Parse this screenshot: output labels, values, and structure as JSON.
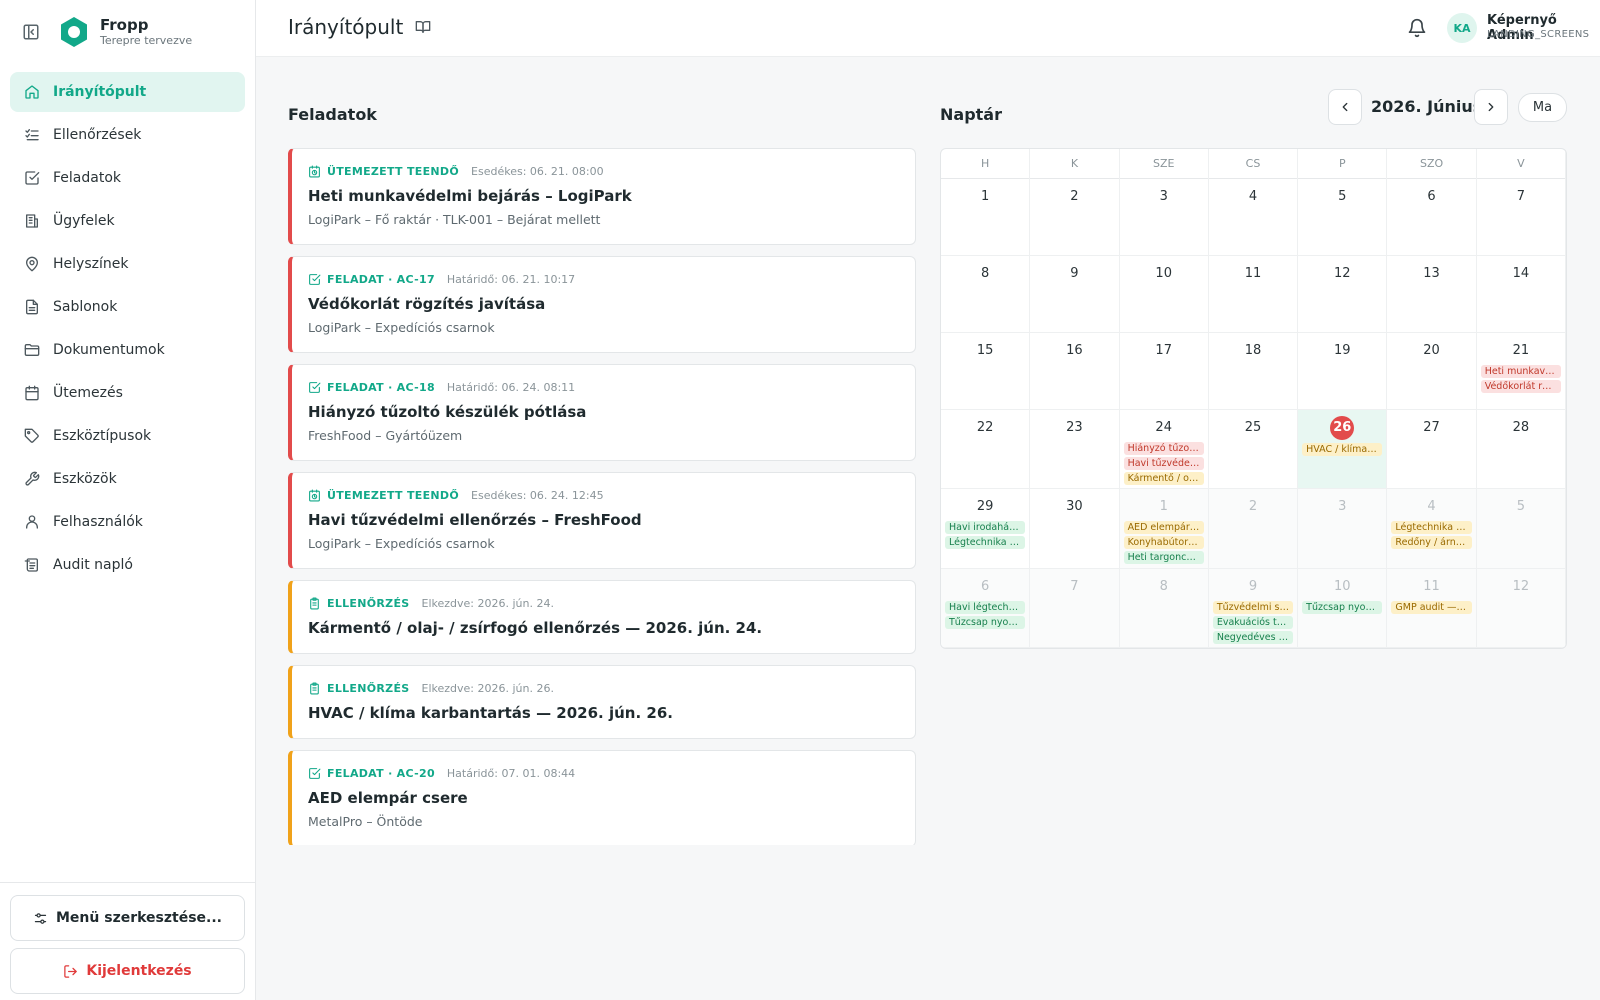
{
  "brand": {
    "name": "Fropp",
    "tagline": "Terepre tervezve"
  },
  "nav": [
    {
      "label": "Irányítópult",
      "icon": "home-icon",
      "active": true
    },
    {
      "label": "Ellenőrzések",
      "icon": "checklist-icon"
    },
    {
      "label": "Feladatok",
      "icon": "checkbox-icon"
    },
    {
      "label": "Ügyfelek",
      "icon": "building-icon"
    },
    {
      "label": "Helyszínek",
      "icon": "map-pin-icon"
    },
    {
      "label": "Sablonok",
      "icon": "file-text-icon"
    },
    {
      "label": "Dokumentumok",
      "icon": "folder-icon"
    },
    {
      "label": "Ütemezés",
      "icon": "calendar-icon"
    },
    {
      "label": "Eszköztípusok",
      "icon": "tag-icon"
    },
    {
      "label": "Eszközök",
      "icon": "wrench-icon"
    },
    {
      "label": "Felhasználók",
      "icon": "user-icon"
    },
    {
      "label": "Audit napló",
      "icon": "log-icon"
    }
  ],
  "sidebar_bottom": {
    "edit_menu": "Menü szerkesztése...",
    "logout": "Kijelentkezés"
  },
  "header": {
    "title": "Irányítópult"
  },
  "user": {
    "initials": "KA",
    "name": "Képernyő Admin",
    "org": "LANDING_SCREENS"
  },
  "tasks_section": {
    "title": "Feladatok",
    "items": [
      {
        "kind": "scheduled",
        "type": "ÜTEMEZETT TEENDŐ",
        "due": "Esedékes: 06. 21. 08:00",
        "title": "Heti munkavédelmi bejárás – LogiPark",
        "sub": "LogiPark – Fő raktár · TLK-001 – Bejárat mellett",
        "color": "red"
      },
      {
        "kind": "task",
        "type": "FELADAT · AC-17",
        "due": "Határidő: 06. 21. 10:17",
        "title": "Védőkorlát rögzítés javítása",
        "sub": "LogiPark – Expedíciós csarnok",
        "color": "red"
      },
      {
        "kind": "task",
        "type": "FELADAT · AC-18",
        "due": "Határidő: 06. 24. 08:11",
        "title": "Hiányzó tűzoltó készülék pótlása",
        "sub": "FreshFood – Gyártóüzem",
        "color": "red"
      },
      {
        "kind": "scheduled",
        "type": "ÜTEMEZETT TEENDŐ",
        "due": "Esedékes: 06. 24. 12:45",
        "title": "Havi tűzvédelmi ellenőrzés – FreshFood",
        "sub": "LogiPark – Expedíciós csarnok",
        "color": "red"
      },
      {
        "kind": "inspection",
        "type": "ELLENŐRZÉS",
        "due": "Elkezdve: 2026. jún. 24.",
        "title": "Kármentő / olaj- / zsírfogó ellenőrzés — 2026. jún. 24.",
        "sub": "",
        "color": "orange"
      },
      {
        "kind": "inspection",
        "type": "ELLENŐRZÉS",
        "due": "Elkezdve: 2026. jún. 26.",
        "title": "HVAC / klíma karbantartás — 2026. jún. 26.",
        "sub": "",
        "color": "orange"
      },
      {
        "kind": "task",
        "type": "FELADAT · AC-20",
        "due": "Határidő: 07. 01. 08:44",
        "title": "AED elempár csere",
        "sub": "MetalPro – Öntöde",
        "color": "orange"
      }
    ]
  },
  "calendar": {
    "title": "Naptár",
    "month": "2026. Június",
    "today_label": "Ma",
    "weekdays": [
      "H",
      "K",
      "SZE",
      "CS",
      "P",
      "SZO",
      "V"
    ],
    "days": [
      {
        "d": "1"
      },
      {
        "d": "2"
      },
      {
        "d": "3"
      },
      {
        "d": "4"
      },
      {
        "d": "5"
      },
      {
        "d": "6"
      },
      {
        "d": "7"
      },
      {
        "d": "8"
      },
      {
        "d": "9"
      },
      {
        "d": "10"
      },
      {
        "d": "11"
      },
      {
        "d": "12"
      },
      {
        "d": "13"
      },
      {
        "d": "14"
      },
      {
        "d": "15"
      },
      {
        "d": "16"
      },
      {
        "d": "17"
      },
      {
        "d": "18"
      },
      {
        "d": "19"
      },
      {
        "d": "20"
      },
      {
        "d": "21",
        "events": [
          {
            "t": "Heti munkavé...",
            "c": "red"
          },
          {
            "t": "Védőkorlát rög...",
            "c": "red"
          }
        ]
      },
      {
        "d": "22"
      },
      {
        "d": "23"
      },
      {
        "d": "24",
        "events": [
          {
            "t": "Hiányzó tűzolt...",
            "c": "red"
          },
          {
            "t": "Havi tűzvédel...",
            "c": "red"
          },
          {
            "t": "Kármentő / ola...",
            "c": "yellow"
          }
        ]
      },
      {
        "d": "25"
      },
      {
        "d": "26",
        "today": true,
        "events": [
          {
            "t": "HVAC / klíma k...",
            "c": "yellow"
          }
        ]
      },
      {
        "d": "27"
      },
      {
        "d": "28"
      },
      {
        "d": "29",
        "events": [
          {
            "t": "Havi irodaház ...",
            "c": "green"
          },
          {
            "t": "Légtechnika sz...",
            "c": "green"
          }
        ]
      },
      {
        "d": "30"
      },
      {
        "d": "1",
        "other": true,
        "events": [
          {
            "t": "AED elempár c...",
            "c": "yellow"
          },
          {
            "t": "Konyhabútor / ...",
            "c": "yellow"
          },
          {
            "t": "Heti targonca ...",
            "c": "green"
          }
        ]
      },
      {
        "d": "2",
        "other": true
      },
      {
        "d": "3",
        "other": true
      },
      {
        "d": "4",
        "other": true,
        "events": [
          {
            "t": "Légtechnika sz...",
            "c": "yellow"
          },
          {
            "t": "Redőny / árnyé...",
            "c": "yellow"
          }
        ]
      },
      {
        "d": "5",
        "other": true
      },
      {
        "d": "6",
        "other": true,
        "events": [
          {
            "t": "Havi légtechni...",
            "c": "green"
          },
          {
            "t": "Tűzcsap nyom...",
            "c": "green"
          }
        ]
      },
      {
        "d": "7",
        "other": true
      },
      {
        "d": "8",
        "other": true
      },
      {
        "d": "9",
        "other": true,
        "events": [
          {
            "t": "Tűzvédelmi sze...",
            "c": "yellow"
          },
          {
            "t": "Evakuációs ter...",
            "c": "green"
          },
          {
            "t": "Negyedéves EP...",
            "c": "green"
          }
        ]
      },
      {
        "d": "10",
        "other": true,
        "events": [
          {
            "t": "Tűzcsap nyom...",
            "c": "green"
          }
        ]
      },
      {
        "d": "11",
        "other": true,
        "events": [
          {
            "t": "GMP audit — 2...",
            "c": "yellow"
          }
        ]
      },
      {
        "d": "12",
        "other": true
      }
    ]
  }
}
